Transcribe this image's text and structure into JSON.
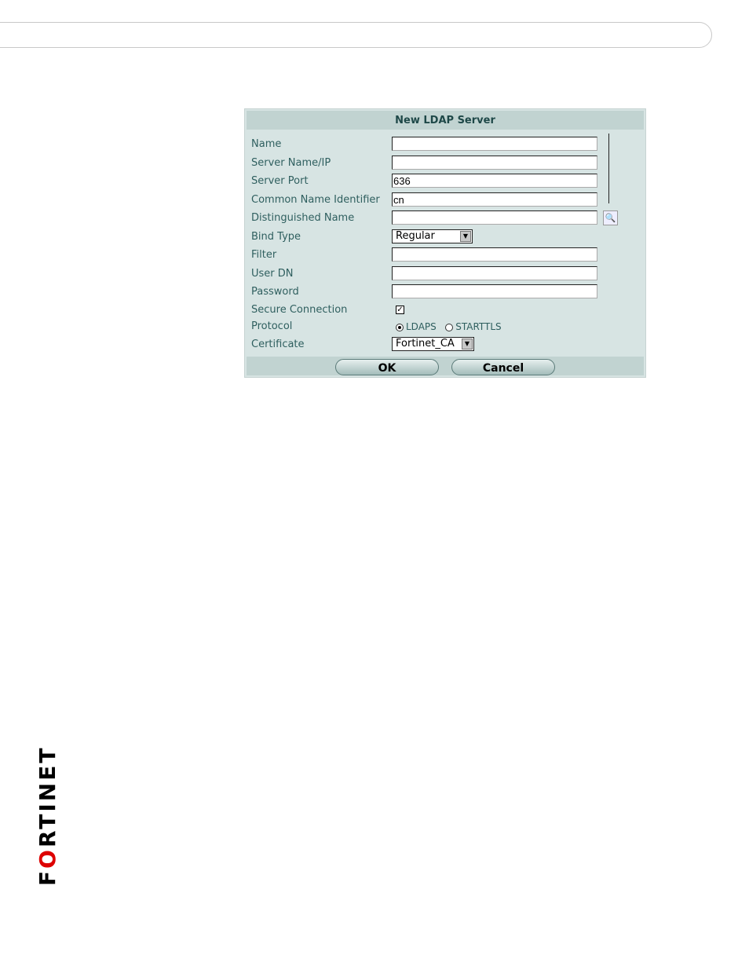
{
  "dialog": {
    "title": "New LDAP Server",
    "fields": [
      {
        "label": "Name",
        "value": ""
      },
      {
        "label": "Server Name/IP",
        "value": ""
      },
      {
        "label": "Server Port",
        "value": "636"
      },
      {
        "label": "Common Name Identifier",
        "value": "cn"
      },
      {
        "label": "Distinguished Name",
        "value": ""
      },
      {
        "label": "Bind Type",
        "value": "Regular"
      },
      {
        "label": "Filter",
        "value": ""
      },
      {
        "label": "User DN",
        "value": ""
      },
      {
        "label": "Password",
        "value": ""
      },
      {
        "label": "Secure Connection",
        "checked": true
      },
      {
        "label": "Protocol",
        "options": [
          "LDAPS",
          "STARTTLS"
        ],
        "selected": "LDAPS"
      },
      {
        "label": "Certificate",
        "value": "Fortinet_CA"
      }
    ],
    "ok_label": "OK",
    "cancel_label": "Cancel"
  },
  "logo": {
    "pre": "F",
    "o": "O",
    "post": "RTINET"
  },
  "colors": {
    "dialog_bg": "#d7e4e3",
    "header_bg": "#c1d3d1",
    "label": "#2f5f5f",
    "logo_red": "#dd0000"
  }
}
